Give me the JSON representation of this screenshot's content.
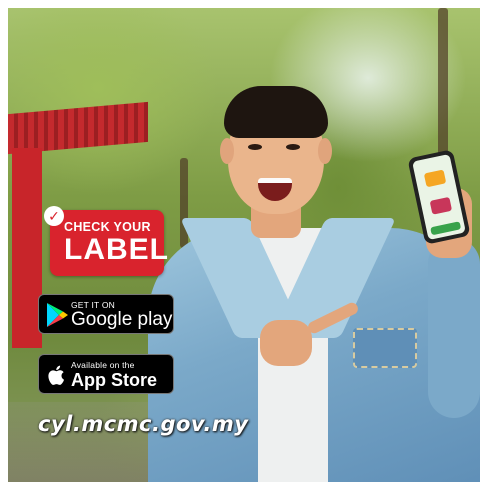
{
  "badge": {
    "line1": "CHECK YOUR",
    "line2": "LABEL",
    "check_icon": "checkmark-icon",
    "color": "#d9232d"
  },
  "google_play": {
    "small_text": "GET IT ON",
    "name": "Google play",
    "icon": "google-play-icon"
  },
  "app_store": {
    "small_text": "Available on the",
    "name": "App Store",
    "icon": "apple-icon"
  },
  "url": "cyl.mcmc.gov.my"
}
